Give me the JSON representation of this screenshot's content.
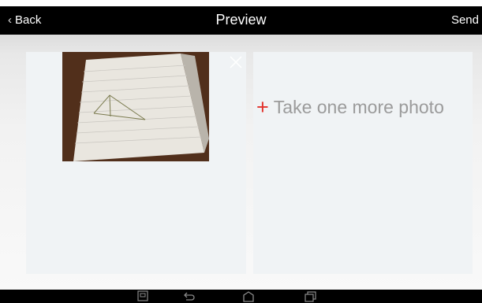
{
  "header": {
    "back_label": "Back",
    "title": "Preview",
    "send_label": "Send"
  },
  "photo_card": {
    "thumbnail": "photo of notebook page with pencil-drawn triangle",
    "remove_icon": "close-icon"
  },
  "add_card": {
    "icon": "plus-icon",
    "label": "Take one more photo"
  },
  "navigation_bar": {
    "icons": [
      "screenshot-icon",
      "back-icon",
      "home-icon",
      "recent-apps-icon"
    ]
  },
  "colors": {
    "header_bg": "#000000",
    "accent_plus": "#e2312b",
    "card_bg": "#f0f3f5",
    "muted_text": "#9b9b9b"
  }
}
